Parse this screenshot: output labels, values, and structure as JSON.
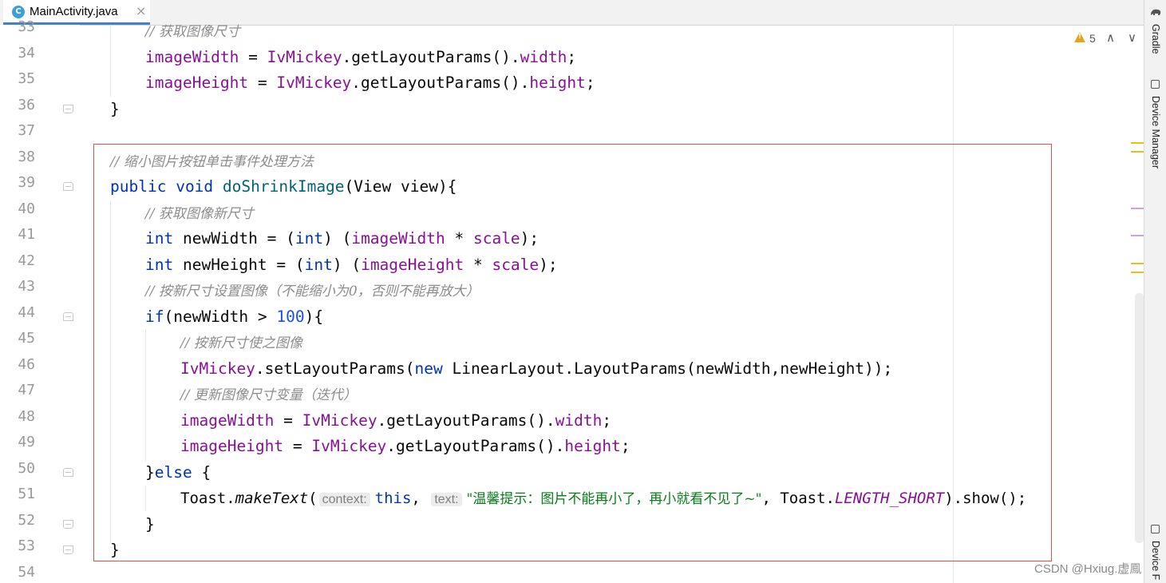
{
  "tab": {
    "label": "MainActivity.java",
    "icon_letter": "C",
    "close": "×"
  },
  "inspection": {
    "warning_count": "5",
    "up": "∧",
    "down": "∨"
  },
  "right_panel": {
    "gradle": "Gradle",
    "device_manager": "Device Manager",
    "device_file": "Device F"
  },
  "watermark": "CSDN @Hxiug.虚鳯",
  "colors": {
    "keyword": "#0033b3",
    "field": "#871094",
    "method": "#00627a",
    "comment": "#8c8c8c",
    "string": "#067d17",
    "number": "#1750eb",
    "highlight_box": "#d9534f",
    "tab_underline": "#4083c9"
  },
  "line_numbers": [
    "33",
    "34",
    "35",
    "36",
    "37",
    "38",
    "39",
    "40",
    "41",
    "42",
    "43",
    "44",
    "45",
    "46",
    "47",
    "48",
    "49",
    "50",
    "51",
    "52",
    "53",
    "54"
  ],
  "code": {
    "l33_comment": "// 获取图像尺寸",
    "l34_field": "imageWidth",
    "l34_op": " = ",
    "l34_obj": "IvMickey",
    "l34_call": ".getLayoutParams().",
    "l34_prop": "width",
    "l34_end": ";",
    "l35_field": "imageHeight",
    "l35_op": " = ",
    "l35_obj": "IvMickey",
    "l35_call": ".getLayoutParams().",
    "l35_prop": "height",
    "l35_end": ";",
    "l36": "}",
    "l38_comment": "// 缩小图片按钮单击事件处理方法",
    "l39_kw1": "public",
    "l39_kw2": "void",
    "l39_fn": "doShrinkImage",
    "l39_rest": "(View view){",
    "l40_comment": "// 获取图像新尺寸",
    "l41_kw": "int",
    "l41_a": " newWidth = (",
    "l41_kw2": "int",
    "l41_b": ") (",
    "l41_f1": "imageWidth",
    "l41_c": " * ",
    "l41_f2": "scale",
    "l41_d": ");",
    "l42_kw": "int",
    "l42_a": " newHeight = (",
    "l42_kw2": "int",
    "l42_b": ") (",
    "l42_f1": "imageHeight",
    "l42_c": " * ",
    "l42_f2": "scale",
    "l42_d": ");",
    "l43_comment": "// 按新尺寸设置图像（不能缩小为0，否则不能再放大）",
    "l44_kw": "if",
    "l44_a": "(newWidth > ",
    "l44_num": "100",
    "l44_b": "){",
    "l45_comment": "// 按新尺寸使之图像",
    "l46_obj": "IvMickey",
    "l46_a": ".setLayoutParams(",
    "l46_kw": "new",
    "l46_b": " LinearLayout.LayoutParams(newWidth,newHeight));",
    "l47_comment": "// 更新图像尺寸变量（迭代）",
    "l48_field": "imageWidth",
    "l48_op": " = ",
    "l48_obj": "IvMickey",
    "l48_call": ".getLayoutParams().",
    "l48_prop": "width",
    "l48_end": ";",
    "l49_field": "imageHeight",
    "l49_op": " = ",
    "l49_obj": "IvMickey",
    "l49_call": ".getLayoutParams().",
    "l49_prop": "height",
    "l49_end": ";",
    "l50_a": "}",
    "l50_kw": "else",
    "l50_b": " {",
    "l51_a": "Toast.",
    "l51_fn": "makeText",
    "l51_b": "(",
    "l51_hint1": "context:",
    "l51_kw": "this",
    "l51_c": ",",
    "l51_hint2": "text:",
    "l51_str": "\"温馨提示：图片不能再小了，再小就看不见了~\"",
    "l51_d": ", Toast.",
    "l51_const": "LENGTH_SHORT",
    "l51_e": ").show();",
    "l52": "}",
    "l53": "}"
  }
}
